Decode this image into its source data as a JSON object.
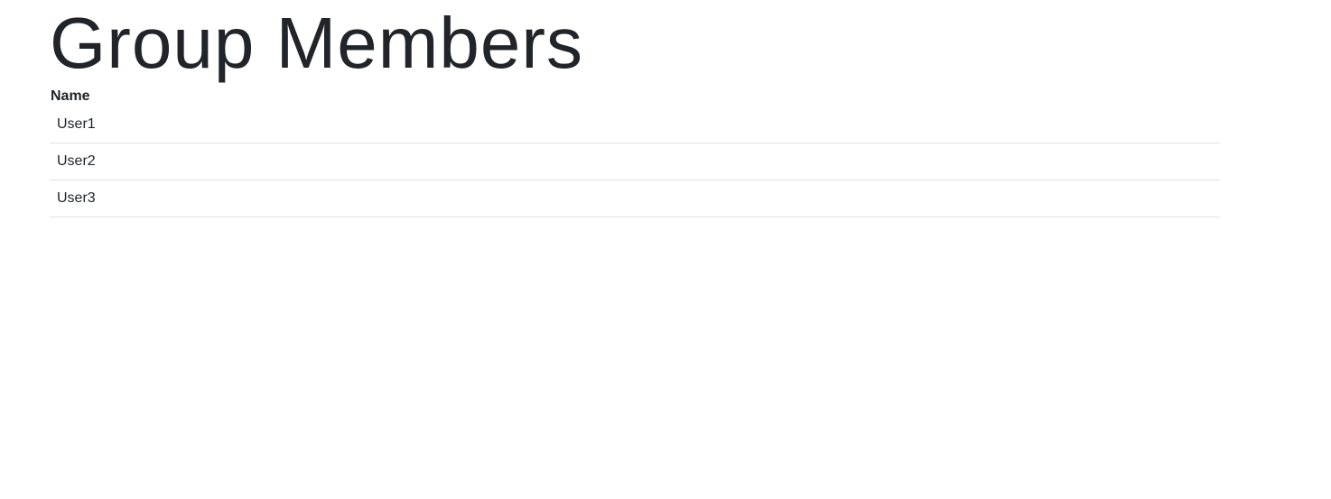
{
  "page": {
    "title": "Group Members"
  },
  "members_table": {
    "columns": [
      "Name"
    ],
    "rows": [
      {
        "name": "User1"
      },
      {
        "name": "User2"
      },
      {
        "name": "User3"
      }
    ]
  }
}
